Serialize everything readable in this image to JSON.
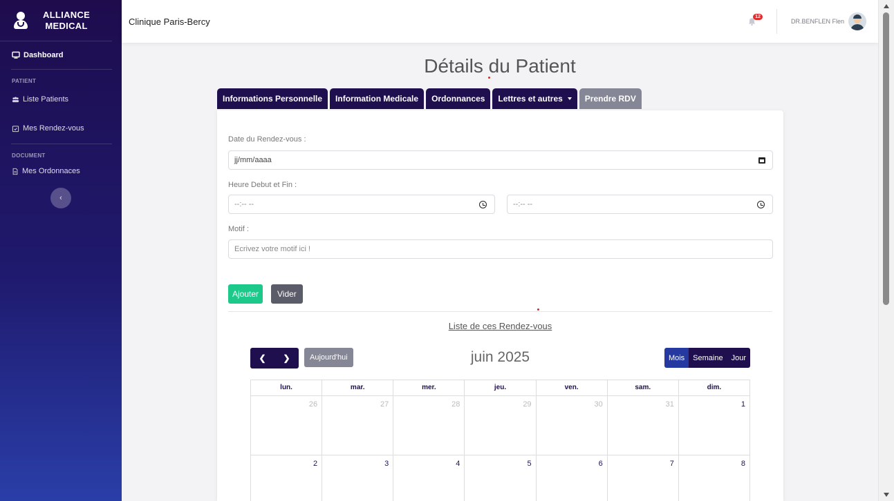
{
  "brand": {
    "line1": "ALLIANCE",
    "line2": "MEDICAL"
  },
  "sidebar": {
    "dashboard": "Dashboard",
    "section_patient": "PATIENT",
    "liste_patients": "Liste Patients",
    "mes_rendez_vous": "Mes Rendez-vous",
    "section_document": "DOCUMENT",
    "mes_ordonnances": "Mes Ordonnaces"
  },
  "topbar": {
    "clinic": "Clinique Paris-Bercy",
    "notifications_count": "12",
    "user_name": "DR.BENFLEN Flen"
  },
  "page": {
    "title": "Détails du Patient"
  },
  "tabs": [
    {
      "label": "Informations Personnelle"
    },
    {
      "label": "Information Medicale"
    },
    {
      "label": "Ordonnances"
    },
    {
      "label": "Lettres et autres"
    },
    {
      "label": "Prendre RDV"
    }
  ],
  "form": {
    "date_label": "Date du Rendez-vous :",
    "date_placeholder": "jj/mm/aaaa",
    "time_label": "Heure Debut et Fin :",
    "time_start_placeholder": "--:-- --",
    "time_end_placeholder": "--:-- --",
    "motif_label": "Motif :",
    "motif_placeholder": "Ecrivez votre motif ici !",
    "add_button": "Ajouter",
    "clear_button": "Vider"
  },
  "rdv_list_title": "Liste de ces Rendez-vous",
  "calendar": {
    "today_label": "Aujourd'hui",
    "title": "juin 2025",
    "views": [
      "Mois",
      "Semaine",
      "Jour"
    ],
    "weekdays": [
      "lun.",
      "mar.",
      "mer.",
      "jeu.",
      "ven.",
      "sam.",
      "dim."
    ],
    "weeks": [
      [
        "26",
        "27",
        "28",
        "29",
        "30",
        "31",
        "1"
      ],
      [
        "2",
        "3",
        "4",
        "5",
        "6",
        "7",
        "8"
      ]
    ]
  },
  "colors": {
    "primary": "#1f0f4f",
    "active_tab": "#858796",
    "success": "#1cc88a",
    "secondary": "#5a5c69",
    "active_view": "#2539a1",
    "badge": "#e02d2d"
  }
}
